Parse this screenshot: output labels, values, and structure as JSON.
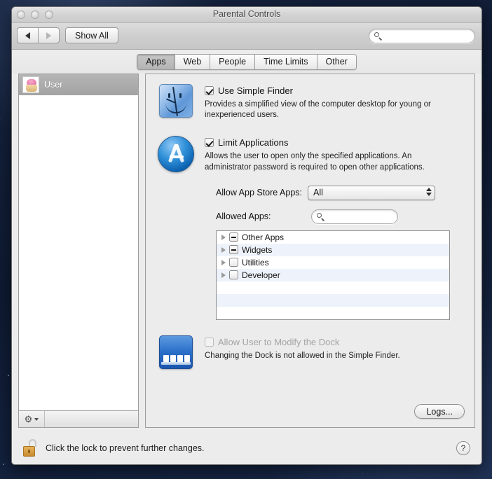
{
  "window": {
    "title": "Parental Controls",
    "traffic_lights": [
      "close-button",
      "minimize-button",
      "zoom-button"
    ]
  },
  "toolbar": {
    "back_label": "back-arrow",
    "forward_label": "forward-arrow",
    "show_all_label": "Show All",
    "search_value": "",
    "search_placeholder": ""
  },
  "tabs": [
    {
      "label": "Apps",
      "active": true
    },
    {
      "label": "Web",
      "active": false
    },
    {
      "label": "People",
      "active": false
    },
    {
      "label": "Time Limits",
      "active": false
    },
    {
      "label": "Other",
      "active": false
    }
  ],
  "sidebar": {
    "users": [
      {
        "name": "User",
        "selected": true,
        "avatar": "cupcake-avatar"
      }
    ],
    "action_menu": "gear-icon"
  },
  "simple_finder": {
    "icon": "finder-icon",
    "checkbox_state": "checked",
    "label": "Use Simple Finder",
    "description": "Provides a simplified view of the computer desktop for young or inexperienced users."
  },
  "limit_applications": {
    "icon": "app-store-icon",
    "checkbox_state": "checked",
    "label": "Limit Applications",
    "description": "Allows the user to open only the specified applications. An administrator password is required to open other applications."
  },
  "app_store_popup": {
    "label": "Allow App Store Apps:",
    "value": "All"
  },
  "allowed_apps": {
    "label": "Allowed Apps:",
    "search_value": "",
    "search_placeholder": "",
    "rows": [
      {
        "label": "Other Apps",
        "checkbox_state": "mixed",
        "expanded": false
      },
      {
        "label": "Widgets",
        "checkbox_state": "mixed",
        "expanded": false
      },
      {
        "label": "Utilities",
        "checkbox_state": "unchecked",
        "expanded": false
      },
      {
        "label": "Developer",
        "checkbox_state": "unchecked",
        "expanded": false
      }
    ]
  },
  "dock_section": {
    "icon": "dock-icon",
    "checkbox_state": "unchecked",
    "disabled": true,
    "label": "Allow User to Modify the Dock",
    "description": "Changing the Dock is not allowed in the Simple Finder."
  },
  "logs_button": "Logs...",
  "bottom_bar": {
    "lock_icon": "unlocked-padlock-icon",
    "message": "Click the lock to prevent further changes.",
    "help_label": "?"
  },
  "colors": {
    "accent_blue": "#2f8fd8",
    "window_chrome": "#ececec",
    "selected_row": "#aeaeae",
    "alt_row": "#eef3fb",
    "desktop": "#122040"
  }
}
